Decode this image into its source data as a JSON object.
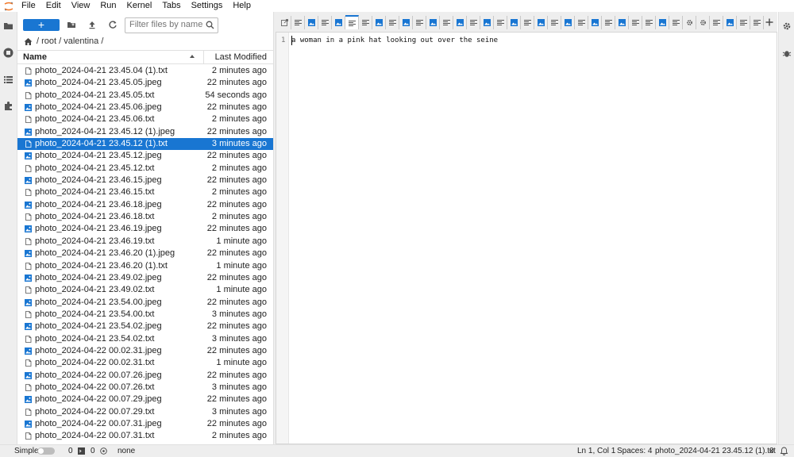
{
  "menu": [
    "File",
    "Edit",
    "View",
    "Run",
    "Kernel",
    "Tabs",
    "Settings",
    "Help"
  ],
  "toolbar": {
    "new_label": "+",
    "filter_placeholder": "Filter files by name"
  },
  "breadcrumb": "/ root / valentina /",
  "list_header": {
    "name": "Name",
    "modified": "Last Modified"
  },
  "files": [
    {
      "name": "photo_2024-04-21 23.45.04 (1).txt",
      "modified": "2 minutes ago",
      "type": "txt"
    },
    {
      "name": "photo_2024-04-21 23.45.05.jpeg",
      "modified": "22 minutes ago",
      "type": "img"
    },
    {
      "name": "photo_2024-04-21 23.45.05.txt",
      "modified": "54 seconds ago",
      "type": "txt"
    },
    {
      "name": "photo_2024-04-21 23.45.06.jpeg",
      "modified": "22 minutes ago",
      "type": "img"
    },
    {
      "name": "photo_2024-04-21 23.45.06.txt",
      "modified": "2 minutes ago",
      "type": "txt"
    },
    {
      "name": "photo_2024-04-21 23.45.12 (1).jpeg",
      "modified": "22 minutes ago",
      "type": "img"
    },
    {
      "name": "photo_2024-04-21 23.45.12 (1).txt",
      "modified": "3 minutes ago",
      "type": "txt",
      "selected": true
    },
    {
      "name": "photo_2024-04-21 23.45.12.jpeg",
      "modified": "22 minutes ago",
      "type": "img"
    },
    {
      "name": "photo_2024-04-21 23.45.12.txt",
      "modified": "2 minutes ago",
      "type": "txt"
    },
    {
      "name": "photo_2024-04-21 23.46.15.jpeg",
      "modified": "22 minutes ago",
      "type": "img"
    },
    {
      "name": "photo_2024-04-21 23.46.15.txt",
      "modified": "2 minutes ago",
      "type": "txt"
    },
    {
      "name": "photo_2024-04-21 23.46.18.jpeg",
      "modified": "22 minutes ago",
      "type": "img"
    },
    {
      "name": "photo_2024-04-21 23.46.18.txt",
      "modified": "2 minutes ago",
      "type": "txt"
    },
    {
      "name": "photo_2024-04-21 23.46.19.jpeg",
      "modified": "22 minutes ago",
      "type": "img"
    },
    {
      "name": "photo_2024-04-21 23.46.19.txt",
      "modified": "1 minute ago",
      "type": "txt"
    },
    {
      "name": "photo_2024-04-21 23.46.20 (1).jpeg",
      "modified": "22 minutes ago",
      "type": "img"
    },
    {
      "name": "photo_2024-04-21 23.46.20 (1).txt",
      "modified": "1 minute ago",
      "type": "txt"
    },
    {
      "name": "photo_2024-04-21 23.49.02.jpeg",
      "modified": "22 minutes ago",
      "type": "img"
    },
    {
      "name": "photo_2024-04-21 23.49.02.txt",
      "modified": "1 minute ago",
      "type": "txt"
    },
    {
      "name": "photo_2024-04-21 23.54.00.jpeg",
      "modified": "22 minutes ago",
      "type": "img"
    },
    {
      "name": "photo_2024-04-21 23.54.00.txt",
      "modified": "3 minutes ago",
      "type": "txt"
    },
    {
      "name": "photo_2024-04-21 23.54.02.jpeg",
      "modified": "22 minutes ago",
      "type": "img"
    },
    {
      "name": "photo_2024-04-21 23.54.02.txt",
      "modified": "3 minutes ago",
      "type": "txt"
    },
    {
      "name": "photo_2024-04-22 00.02.31.jpeg",
      "modified": "22 minutes ago",
      "type": "img"
    },
    {
      "name": "photo_2024-04-22 00.02.31.txt",
      "modified": "1 minute ago",
      "type": "txt"
    },
    {
      "name": "photo_2024-04-22 00.07.26.jpeg",
      "modified": "22 minutes ago",
      "type": "img"
    },
    {
      "name": "photo_2024-04-22 00.07.26.txt",
      "modified": "3 minutes ago",
      "type": "txt"
    },
    {
      "name": "photo_2024-04-22 00.07.29.jpeg",
      "modified": "22 minutes ago",
      "type": "img"
    },
    {
      "name": "photo_2024-04-22 00.07.29.txt",
      "modified": "3 minutes ago",
      "type": "txt"
    },
    {
      "name": "photo_2024-04-22 00.07.31.jpeg",
      "modified": "22 minutes ago",
      "type": "img"
    },
    {
      "name": "photo_2024-04-22 00.07.31.txt",
      "modified": "2 minutes ago",
      "type": "txt"
    }
  ],
  "tabs": [
    {
      "type": "launcher"
    },
    {
      "type": "txt"
    },
    {
      "type": "img"
    },
    {
      "type": "txt"
    },
    {
      "type": "img"
    },
    {
      "type": "txt",
      "active": true
    },
    {
      "type": "txt"
    },
    {
      "type": "img"
    },
    {
      "type": "txt"
    },
    {
      "type": "img"
    },
    {
      "type": "txt"
    },
    {
      "type": "img"
    },
    {
      "type": "txt"
    },
    {
      "type": "img"
    },
    {
      "type": "txt"
    },
    {
      "type": "img"
    },
    {
      "type": "txt"
    },
    {
      "type": "img"
    },
    {
      "type": "txt"
    },
    {
      "type": "img"
    },
    {
      "type": "txt"
    },
    {
      "type": "img"
    },
    {
      "type": "txt"
    },
    {
      "type": "img"
    },
    {
      "type": "txt"
    },
    {
      "type": "img"
    },
    {
      "type": "txt"
    },
    {
      "type": "txt"
    },
    {
      "type": "img"
    },
    {
      "type": "txt"
    },
    {
      "type": "gear"
    },
    {
      "type": "gear"
    },
    {
      "type": "txt"
    },
    {
      "type": "img"
    },
    {
      "type": "txt"
    },
    {
      "type": "txt"
    }
  ],
  "editor": {
    "line_number": "1",
    "text": "a woman in a pink hat looking out over the seine"
  },
  "status": {
    "mode": "Simple",
    "terminals": "0",
    "kernels": "0",
    "kernel_name": "none",
    "cursor": "Ln 1, Col 1",
    "spaces": "Spaces: 4",
    "file": "photo_2024-04-21 23.45.12 (1).txt",
    "notifications": "0"
  },
  "colors": {
    "accent": "#1976d2",
    "rail": "#eeeeee",
    "logo": "#f37726"
  }
}
